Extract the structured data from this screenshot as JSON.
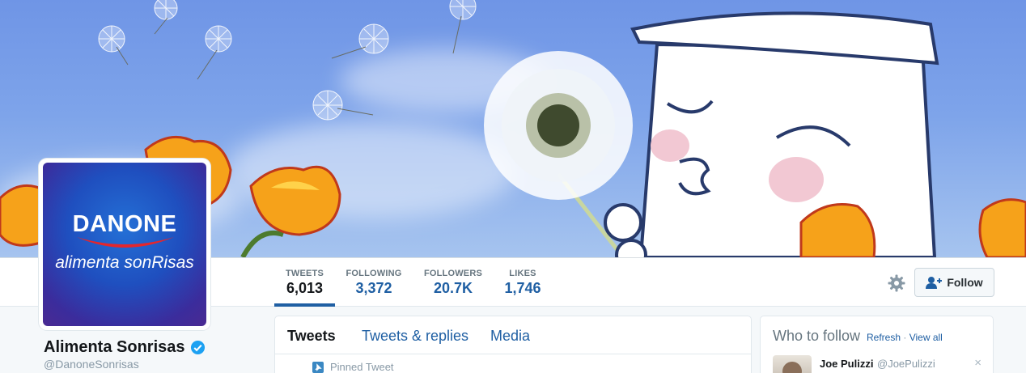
{
  "profile": {
    "name": "Alimenta Sonrisas",
    "handle": "@DanoneSonrisas",
    "avatar_brand": "DANONE",
    "avatar_tagline": "alimenta sonRisas"
  },
  "stats": [
    {
      "label": "TWEETS",
      "value": "6,013"
    },
    {
      "label": "FOLLOWING",
      "value": "3,372"
    },
    {
      "label": "FOLLOWERS",
      "value": "20.7K"
    },
    {
      "label": "LIKES",
      "value": "1,746"
    }
  ],
  "actions": {
    "follow_label": "Follow",
    "settings_icon": "gear-icon",
    "follow_icon": "add-user-icon"
  },
  "timeline": {
    "tabs": [
      "Tweets",
      "Tweets & replies",
      "Media"
    ],
    "pinned_label": "Pinned Tweet"
  },
  "who_to_follow": {
    "title": "Who to follow",
    "refresh_label": "Refresh",
    "separator": "·",
    "view_all_label": "View all",
    "suggestion": {
      "name": "Joe Pulizzi",
      "handle": "@JoePulizzi"
    },
    "dismiss": "×"
  },
  "colors": {
    "link": "#1f5fa3",
    "verified": "#1da1f2",
    "brand_red": "#e4262c",
    "sky": "#7ea4ea"
  }
}
